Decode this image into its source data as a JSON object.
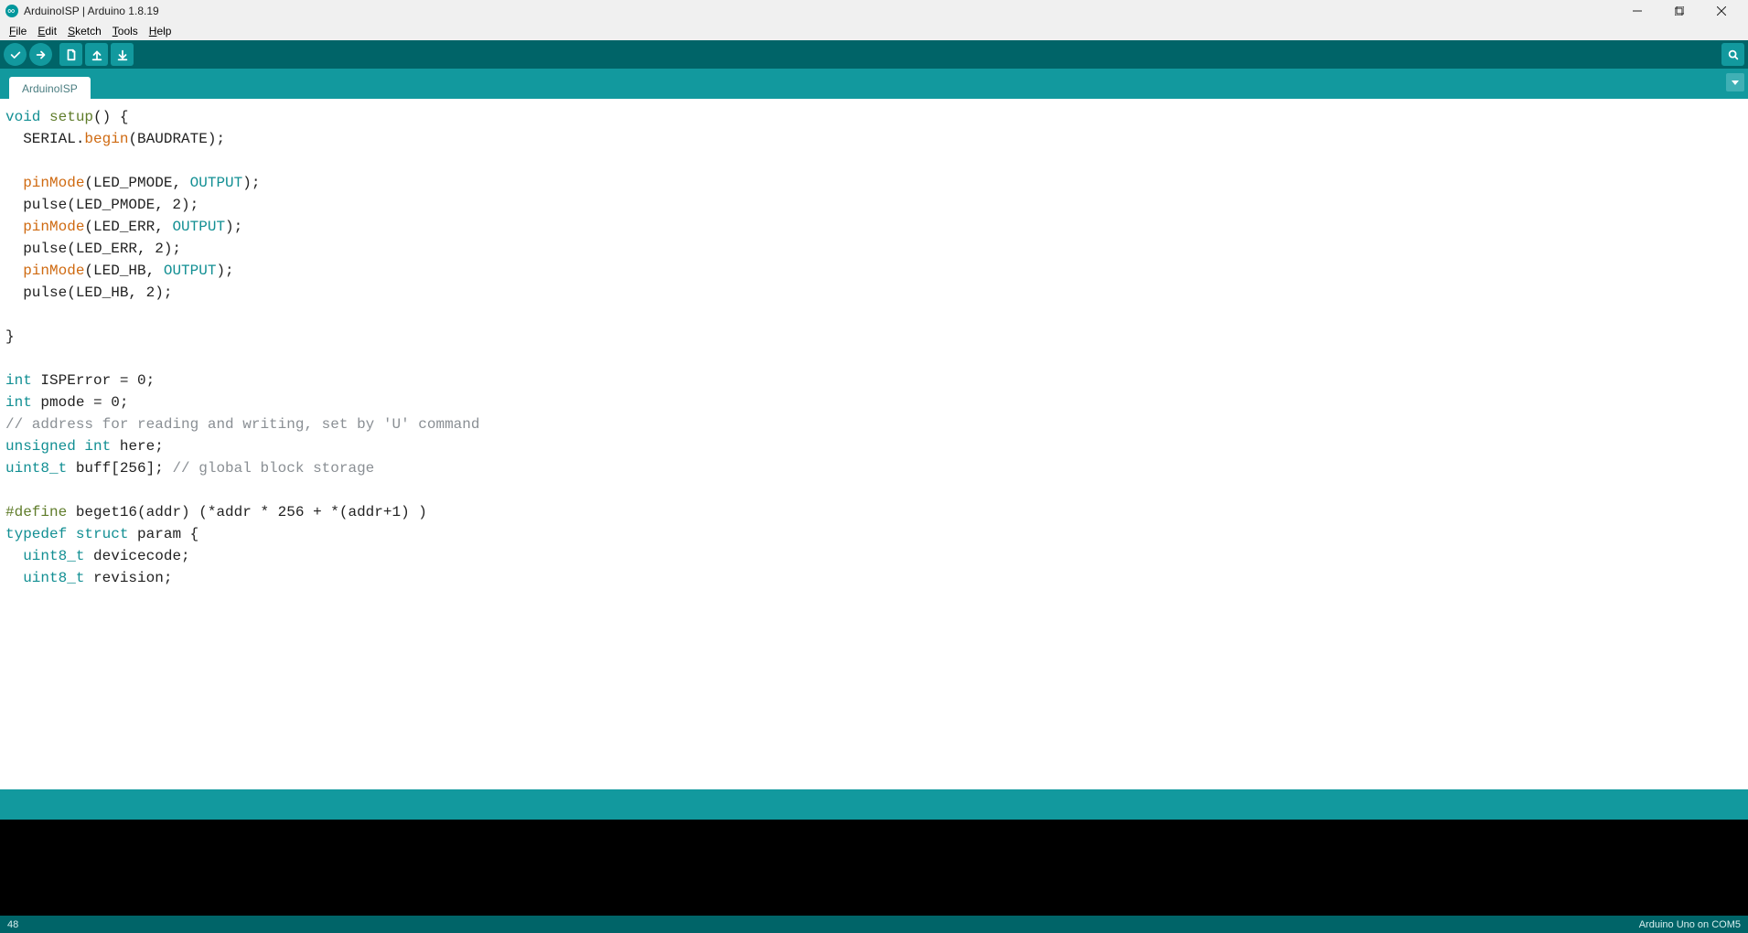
{
  "titlebar": {
    "title": "ArduinoISP | Arduino 1.8.19"
  },
  "menubar": {
    "items": [
      {
        "u": "F",
        "rest": "ile"
      },
      {
        "u": "E",
        "rest": "dit"
      },
      {
        "u": "S",
        "rest": "ketch"
      },
      {
        "u": "T",
        "rest": "ools"
      },
      {
        "u": "H",
        "rest": "elp"
      }
    ]
  },
  "tabs": {
    "active": "ArduinoISP"
  },
  "code_tokens": [
    [
      {
        "c": "kw-type",
        "t": "void"
      },
      {
        "t": " "
      },
      {
        "c": "kw-pre",
        "t": "setup"
      },
      {
        "t": "() {"
      }
    ],
    [
      {
        "t": "  SERIAL."
      },
      {
        "c": "kw-func",
        "t": "begin"
      },
      {
        "t": "(BAUDRATE);"
      }
    ],
    [
      {
        "t": ""
      }
    ],
    [
      {
        "t": "  "
      },
      {
        "c": "kw-func",
        "t": "pinMode"
      },
      {
        "t": "(LED_PMODE, "
      },
      {
        "c": "kw-const",
        "t": "OUTPUT"
      },
      {
        "t": ");"
      }
    ],
    [
      {
        "t": "  pulse(LED_PMODE, 2);"
      }
    ],
    [
      {
        "t": "  "
      },
      {
        "c": "kw-func",
        "t": "pinMode"
      },
      {
        "t": "(LED_ERR, "
      },
      {
        "c": "kw-const",
        "t": "OUTPUT"
      },
      {
        "t": ");"
      }
    ],
    [
      {
        "t": "  pulse(LED_ERR, 2);"
      }
    ],
    [
      {
        "t": "  "
      },
      {
        "c": "kw-func",
        "t": "pinMode"
      },
      {
        "t": "(LED_HB, "
      },
      {
        "c": "kw-const",
        "t": "OUTPUT"
      },
      {
        "t": ");"
      }
    ],
    [
      {
        "t": "  pulse(LED_HB, 2);"
      }
    ],
    [
      {
        "t": ""
      }
    ],
    [
      {
        "t": "}"
      }
    ],
    [
      {
        "t": ""
      }
    ],
    [
      {
        "c": "kw-type",
        "t": "int"
      },
      {
        "t": " ISPError = 0;"
      }
    ],
    [
      {
        "c": "kw-type",
        "t": "int"
      },
      {
        "t": " pmode = 0;"
      }
    ],
    [
      {
        "c": "comment",
        "t": "// address for reading and writing, set by 'U' command"
      }
    ],
    [
      {
        "c": "kw-type",
        "t": "unsigned"
      },
      {
        "t": " "
      },
      {
        "c": "kw-type",
        "t": "int"
      },
      {
        "t": " here;"
      }
    ],
    [
      {
        "c": "kw-type",
        "t": "uint8_t"
      },
      {
        "t": " buff[256]; "
      },
      {
        "c": "comment",
        "t": "// global block storage"
      }
    ],
    [
      {
        "t": ""
      }
    ],
    [
      {
        "c": "kw-pre",
        "t": "#define"
      },
      {
        "t": " beget16(addr) (*addr * 256 + *(addr+1) )"
      }
    ],
    [
      {
        "c": "kw-type",
        "t": "typedef"
      },
      {
        "t": " "
      },
      {
        "c": "kw-type",
        "t": "struct"
      },
      {
        "t": " param {"
      }
    ],
    [
      {
        "t": "  "
      },
      {
        "c": "kw-type",
        "t": "uint8_t"
      },
      {
        "t": " devicecode;"
      }
    ],
    [
      {
        "t": "  "
      },
      {
        "c": "kw-type",
        "t": "uint8_t"
      },
      {
        "t": " revision;"
      }
    ]
  ],
  "status": {
    "line": "48",
    "board": "Arduino Uno on COM5"
  },
  "console": ""
}
